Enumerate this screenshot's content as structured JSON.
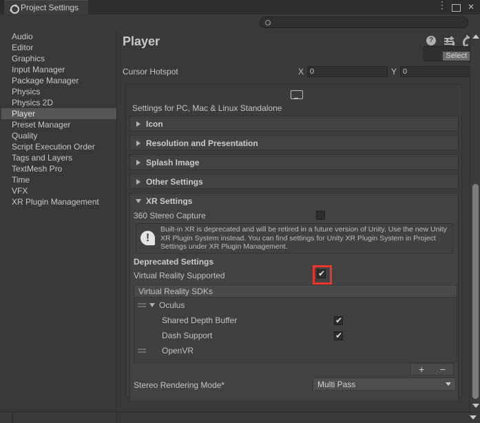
{
  "window": {
    "tab_label": "Project Settings",
    "tab_icon": "gear-icon",
    "menu_icon": "dots-vertical-icon",
    "maximize_icon": "maximize-icon",
    "close_icon": "close-icon"
  },
  "search": {
    "value": "",
    "placeholder": "",
    "icon": "search-icon"
  },
  "sidebar": {
    "items": [
      {
        "label": "Audio",
        "selected": false
      },
      {
        "label": "Editor",
        "selected": false
      },
      {
        "label": "Graphics",
        "selected": false
      },
      {
        "label": "Input Manager",
        "selected": false
      },
      {
        "label": "Package Manager",
        "selected": false
      },
      {
        "label": "Physics",
        "selected": false
      },
      {
        "label": "Physics 2D",
        "selected": false
      },
      {
        "label": "Player",
        "selected": true
      },
      {
        "label": "Preset Manager",
        "selected": false
      },
      {
        "label": "Quality",
        "selected": false
      },
      {
        "label": "Script Execution Order",
        "selected": false
      },
      {
        "label": "Tags and Layers",
        "selected": false
      },
      {
        "label": "TextMesh Pro",
        "selected": false
      },
      {
        "label": "Time",
        "selected": false
      },
      {
        "label": "VFX",
        "selected": false
      },
      {
        "label": "XR Plugin Management",
        "selected": false
      }
    ]
  },
  "main": {
    "title": "Player",
    "header_icons": [
      "help-icon",
      "preset-icon",
      "gear-icon"
    ],
    "select_button": "Select",
    "cursor_hotspot": {
      "label": "Cursor Hotspot",
      "x_label": "X",
      "x_value": "0",
      "y_label": "Y",
      "y_value": "0"
    },
    "platform": {
      "icon": "monitor-icon",
      "caption": "Settings for PC, Mac & Linux Standalone"
    },
    "foldouts": [
      {
        "label": "Icon",
        "expanded": false
      },
      {
        "label": "Resolution and Presentation",
        "expanded": false
      },
      {
        "label": "Splash Image",
        "expanded": false
      },
      {
        "label": "Other Settings",
        "expanded": false
      },
      {
        "label": "XR Settings",
        "expanded": true
      }
    ],
    "xr": {
      "stereo_capture_label": "360 Stereo Capture",
      "stereo_capture_checked": false,
      "warning_icon": "warning-icon",
      "warning_text": "Built-in XR is deprecated and will be retired in a future version of Unity. Use the new Unity XR Plugin System instead. You can find settings for Unity XR Plugin System in Project Settings under XR Plugin Management.",
      "deprecated_label": "Deprecated Settings",
      "vr_supported_label": "Virtual Reality Supported",
      "vr_supported_checked": true,
      "vr_supported_highlight_color": "#f0352b",
      "sdk_header": "Virtual Reality SDKs",
      "sdks": [
        {
          "name": "Oculus",
          "expanded": true,
          "options": [
            {
              "label": "Shared Depth Buffer",
              "checked": true
            },
            {
              "label": "Dash Support",
              "checked": true
            }
          ]
        },
        {
          "name": "OpenVR",
          "expanded": false,
          "options": []
        }
      ],
      "add_button": "+",
      "remove_button": "−",
      "stereo_rendering_label": "Stereo Rendering Mode*",
      "stereo_rendering_value": "Multi Pass"
    }
  },
  "scrollbar": {
    "up_icon": "scroll-up-arrow",
    "down_icon": "scroll-down-arrow"
  },
  "statusbar": {
    "dropdown_icon": "chevron-down-icon"
  }
}
